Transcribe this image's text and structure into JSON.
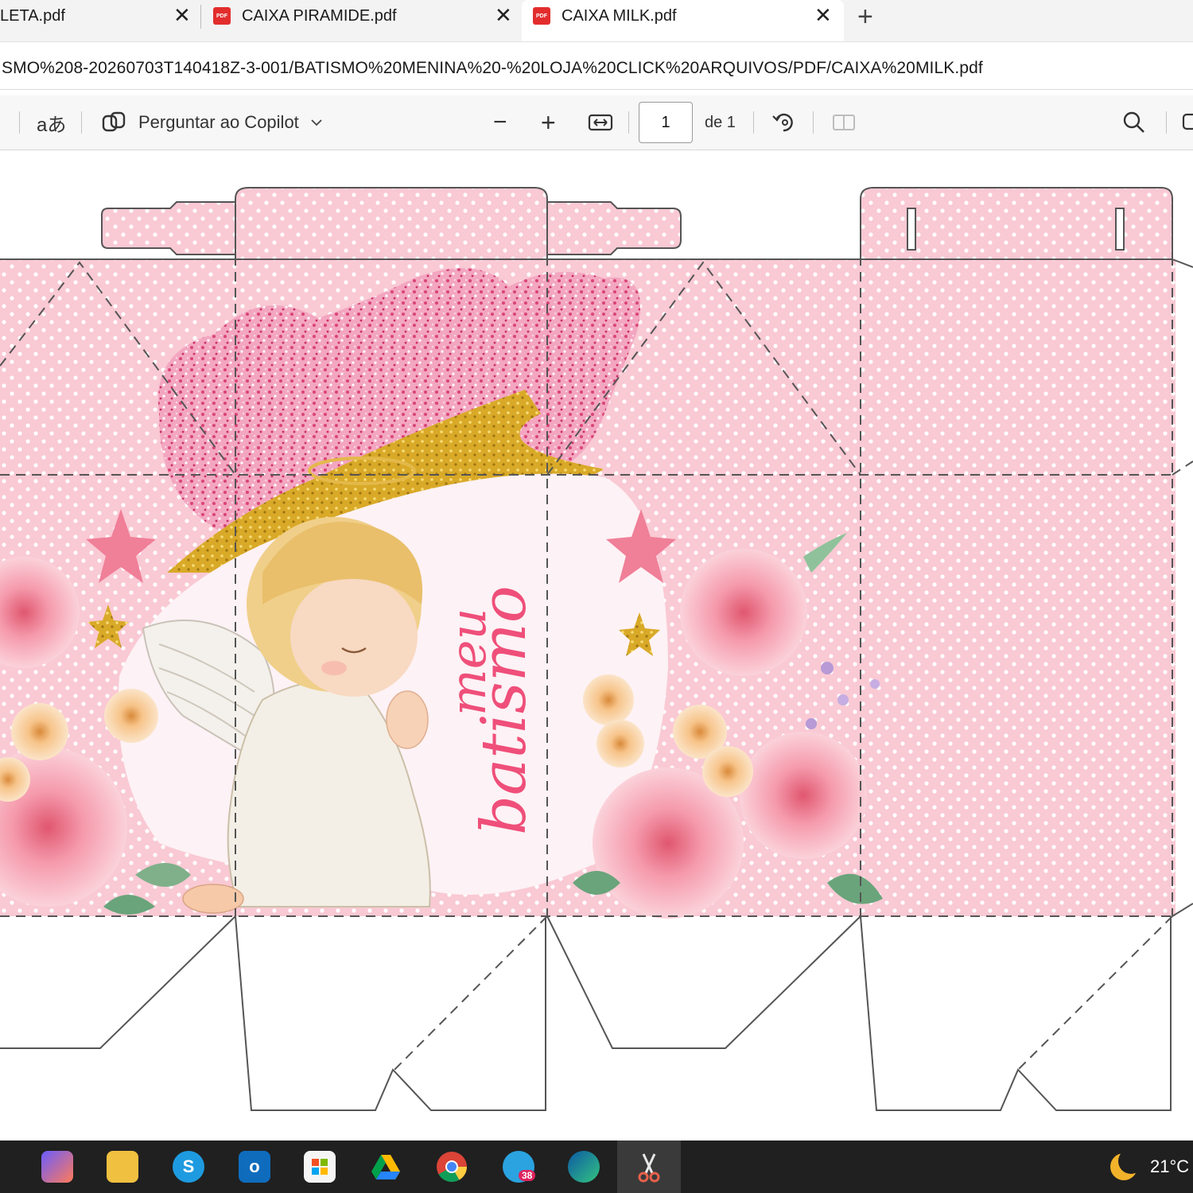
{
  "tabs": [
    {
      "label": "LETA.pdf"
    },
    {
      "label": "CAIXA PIRAMIDE.pdf"
    },
    {
      "label": "CAIXA MILK.pdf"
    }
  ],
  "pdf_icon_text": "PDF",
  "close_glyph": "✕",
  "newtab_glyph": "+",
  "address": {
    "url": "SMO%208-20260703T140418Z-3-001/BATISMO%20MENINA%20-%20LOJA%20CLICK%20ARQUIVOS/PDF/CAIXA%20MILK.pdf"
  },
  "toolbar": {
    "read_aloud_glyph": "aあ",
    "copilot_label": "Perguntar ao Copilot",
    "zoom_out": "−",
    "zoom_in": "+",
    "page_current": "1",
    "page_total": "de 1"
  },
  "document": {
    "text_line1": "meu",
    "text_line2": "batismo",
    "colors": {
      "pink_bg": "#f9c9d4",
      "dots": "#ffffff",
      "script": "#ef4f7a",
      "glitter": "#e8769a",
      "gold": "#d9a928",
      "star": "#f07f98"
    }
  },
  "taskbar": {
    "icons": [
      "copilot-icon",
      "file-explorer-icon",
      "skype-icon",
      "outlook-icon",
      "store-icon",
      "google-drive-icon",
      "chrome-icon",
      "telegram-icon",
      "edge-icon",
      "snipping-tool-icon"
    ],
    "telegram_badge": "38",
    "temperature": "21°C"
  }
}
